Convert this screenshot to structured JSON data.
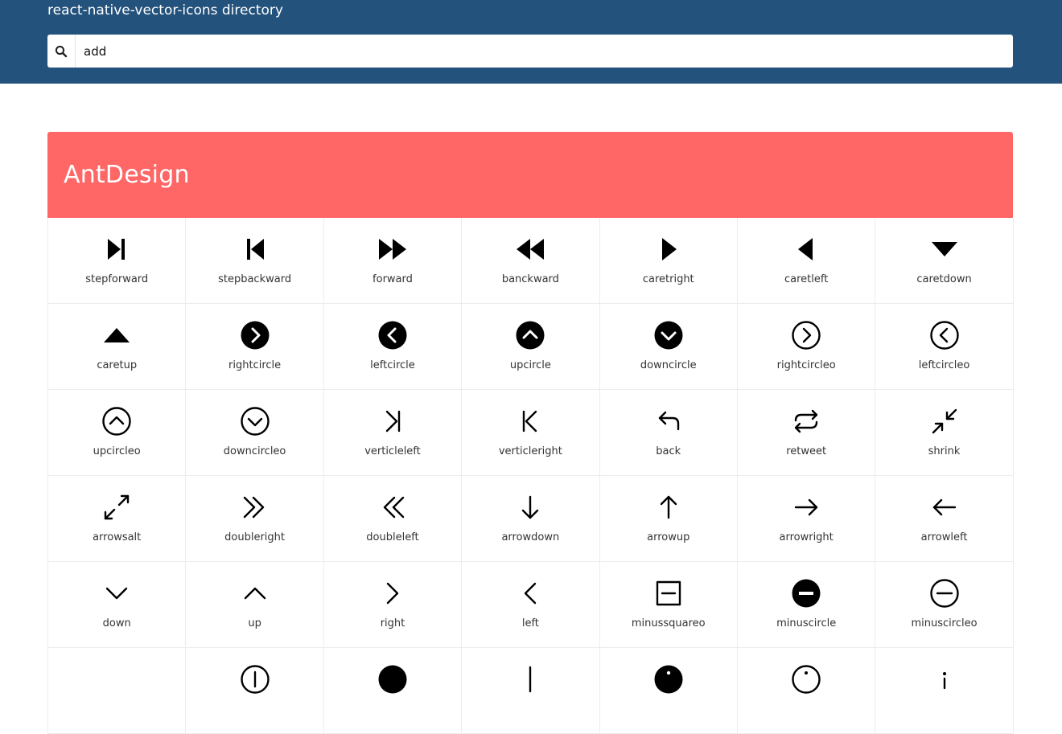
{
  "header": {
    "title": "react-native-vector-icons directory",
    "search_icon": "search-icon",
    "search_value": "add"
  },
  "section": {
    "name": "AntDesign",
    "accent_color": "#ff6666",
    "icons": [
      {
        "label": "stepforward",
        "icon": "stepforward"
      },
      {
        "label": "stepbackward",
        "icon": "stepbackward"
      },
      {
        "label": "forward",
        "icon": "forward"
      },
      {
        "label": "banckward",
        "icon": "banckward"
      },
      {
        "label": "caretright",
        "icon": "caretright"
      },
      {
        "label": "caretleft",
        "icon": "caretleft"
      },
      {
        "label": "caretdown",
        "icon": "caretdown"
      },
      {
        "label": "caretup",
        "icon": "caretup"
      },
      {
        "label": "rightcircle",
        "icon": "rightcircle"
      },
      {
        "label": "leftcircle",
        "icon": "leftcircle"
      },
      {
        "label": "upcircle",
        "icon": "upcircle"
      },
      {
        "label": "downcircle",
        "icon": "downcircle"
      },
      {
        "label": "rightcircleo",
        "icon": "rightcircleo"
      },
      {
        "label": "leftcircleo",
        "icon": "leftcircleo"
      },
      {
        "label": "upcircleo",
        "icon": "upcircleo"
      },
      {
        "label": "downcircleo",
        "icon": "downcircleo"
      },
      {
        "label": "verticleleft",
        "icon": "verticleleft"
      },
      {
        "label": "verticleright",
        "icon": "verticleright"
      },
      {
        "label": "back",
        "icon": "back"
      },
      {
        "label": "retweet",
        "icon": "retweet"
      },
      {
        "label": "shrink",
        "icon": "shrink"
      },
      {
        "label": "arrowsalt",
        "icon": "arrowsalt"
      },
      {
        "label": "doubleright",
        "icon": "doubleright"
      },
      {
        "label": "doubleleft",
        "icon": "doubleleft"
      },
      {
        "label": "arrowdown",
        "icon": "arrowdown"
      },
      {
        "label": "arrowup",
        "icon": "arrowup"
      },
      {
        "label": "arrowright",
        "icon": "arrowright"
      },
      {
        "label": "arrowleft",
        "icon": "arrowleft"
      },
      {
        "label": "down",
        "icon": "down"
      },
      {
        "label": "up",
        "icon": "up"
      },
      {
        "label": "right",
        "icon": "right"
      },
      {
        "label": "left",
        "icon": "left"
      },
      {
        "label": "minussquareo",
        "icon": "minussquareo"
      },
      {
        "label": "minuscircle",
        "icon": "minuscircle"
      },
      {
        "label": "minuscircleo",
        "icon": "minuscircleo"
      },
      {
        "label": "",
        "icon": "partial"
      },
      {
        "label": "",
        "icon": "pluscircleo"
      },
      {
        "label": "",
        "icon": "pluscircle"
      },
      {
        "label": "",
        "icon": "plus"
      },
      {
        "label": "",
        "icon": "infocirlce"
      },
      {
        "label": "",
        "icon": "infocirlceo"
      },
      {
        "label": "",
        "icon": "info"
      }
    ]
  }
}
